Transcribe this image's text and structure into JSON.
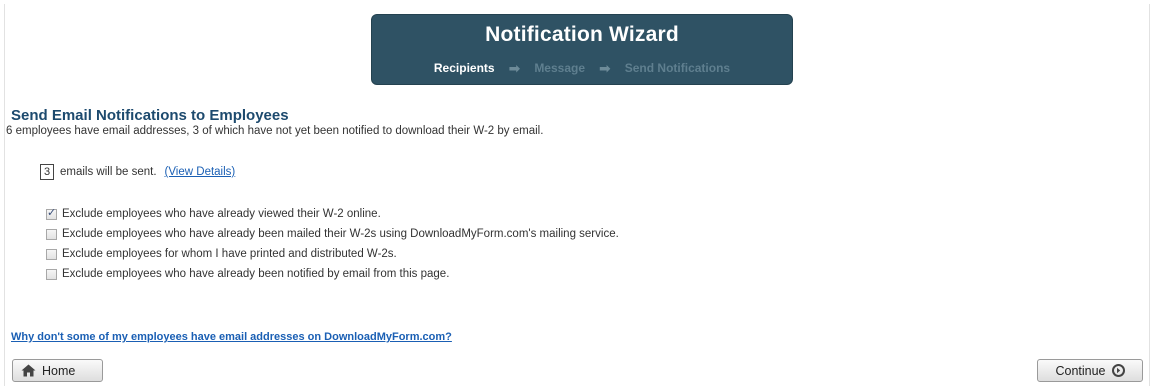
{
  "wizard": {
    "title": "Notification Wizard",
    "steps": [
      {
        "label": "Recipients",
        "state": "active"
      },
      {
        "label": "Message",
        "state": "inactive"
      },
      {
        "label": "Send Notifications",
        "state": "inactive"
      }
    ]
  },
  "main": {
    "section_title": "Send Email Notifications to Employees",
    "summary": "6 employees have email addresses, 3 of which have not yet been notified to download their W-2 by email.",
    "email_count": "3",
    "email_count_suffix": "emails will be sent.",
    "view_details_label": "(View Details)",
    "options": [
      {
        "label": "Exclude employees who have already viewed their W-2 online.",
        "checked": true
      },
      {
        "label": "Exclude employees who have already been mailed their W-2s using DownloadMyForm.com's mailing service.",
        "checked": false
      },
      {
        "label": "Exclude employees for whom I have printed and distributed W-2s.",
        "checked": false
      },
      {
        "label": "Exclude employees who have already been notified by email from this page.",
        "checked": false
      }
    ],
    "help_link": "Why don't some of my employees have email addresses on DownloadMyForm.com?"
  },
  "footer": {
    "home_label": "Home",
    "continue_label": "Continue"
  },
  "colors": {
    "wizard_bg": "#2f5264",
    "title_blue": "#1d4a6e",
    "link_blue": "#1a5fb4"
  }
}
